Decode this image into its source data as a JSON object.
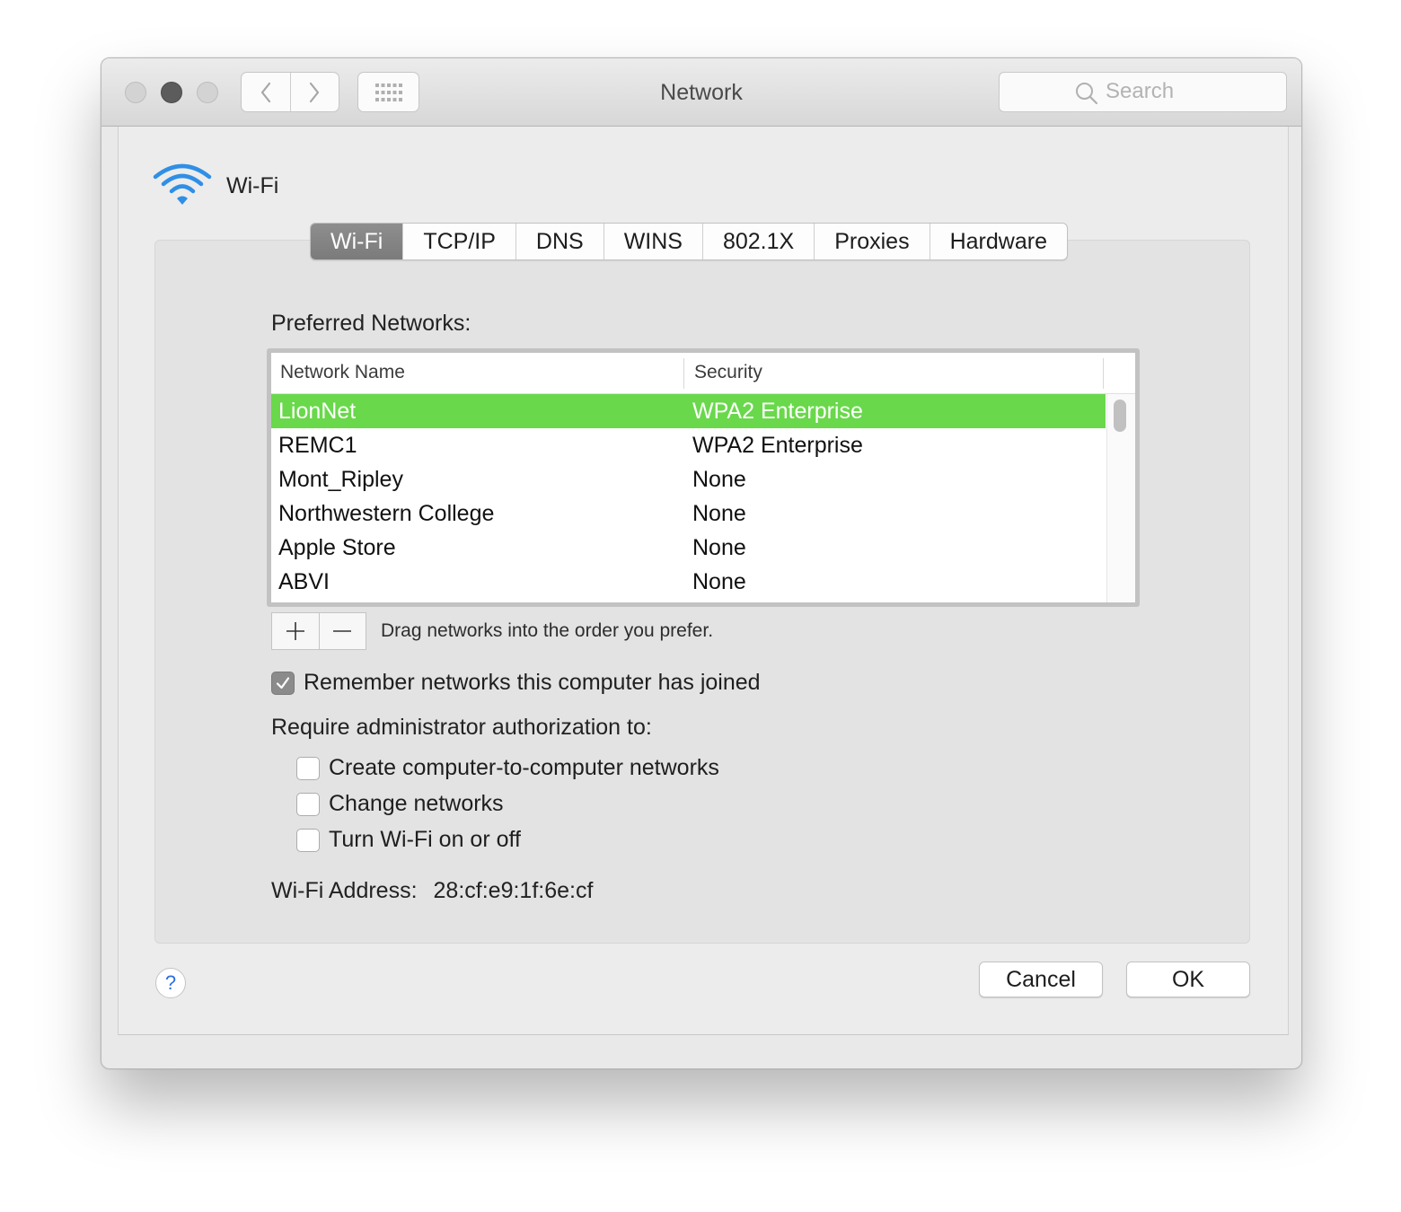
{
  "window": {
    "title": "Network"
  },
  "toolbar": {
    "back_icon": "chevron-left-icon",
    "forward_icon": "chevron-right-icon",
    "show_all_icon": "grid-icon",
    "search_placeholder": "Search"
  },
  "service": {
    "icon": "wifi-icon",
    "name": "Wi-Fi"
  },
  "tabs": [
    {
      "label": "Wi-Fi",
      "active": true
    },
    {
      "label": "TCP/IP",
      "active": false
    },
    {
      "label": "DNS",
      "active": false
    },
    {
      "label": "WINS",
      "active": false
    },
    {
      "label": "802.1X",
      "active": false
    },
    {
      "label": "Proxies",
      "active": false
    },
    {
      "label": "Hardware",
      "active": false
    }
  ],
  "preferred": {
    "label": "Preferred Networks:",
    "columns": [
      "Network Name",
      "Security"
    ],
    "rows": [
      {
        "name": "LionNet",
        "security": "WPA2 Enterprise",
        "selected": true
      },
      {
        "name": "REMC1",
        "security": "WPA2 Enterprise",
        "selected": false
      },
      {
        "name": "Mont_Ripley",
        "security": "None",
        "selected": false
      },
      {
        "name": "Northwestern College",
        "security": "None",
        "selected": false
      },
      {
        "name": "Apple Store",
        "security": "None",
        "selected": false
      },
      {
        "name": "ABVI",
        "security": "None",
        "selected": false
      }
    ],
    "drag_hint": "Drag networks into the order you prefer."
  },
  "options": {
    "remember": {
      "label": "Remember networks this computer has joined",
      "checked": true
    },
    "require_label": "Require administrator authorization to:",
    "admin": [
      {
        "label": "Create computer-to-computer networks",
        "checked": false
      },
      {
        "label": "Change networks",
        "checked": false
      },
      {
        "label": "Turn Wi-Fi on or off",
        "checked": false
      }
    ]
  },
  "address": {
    "label": "Wi-Fi Address:",
    "value": "28:cf:e9:1f:6e:cf"
  },
  "buttons": {
    "help": "?",
    "cancel": "Cancel",
    "ok": "OK"
  },
  "colors": {
    "selection": "#69d84b",
    "active_tab": "#858585",
    "wifi_icon": "#2f8fe6"
  }
}
